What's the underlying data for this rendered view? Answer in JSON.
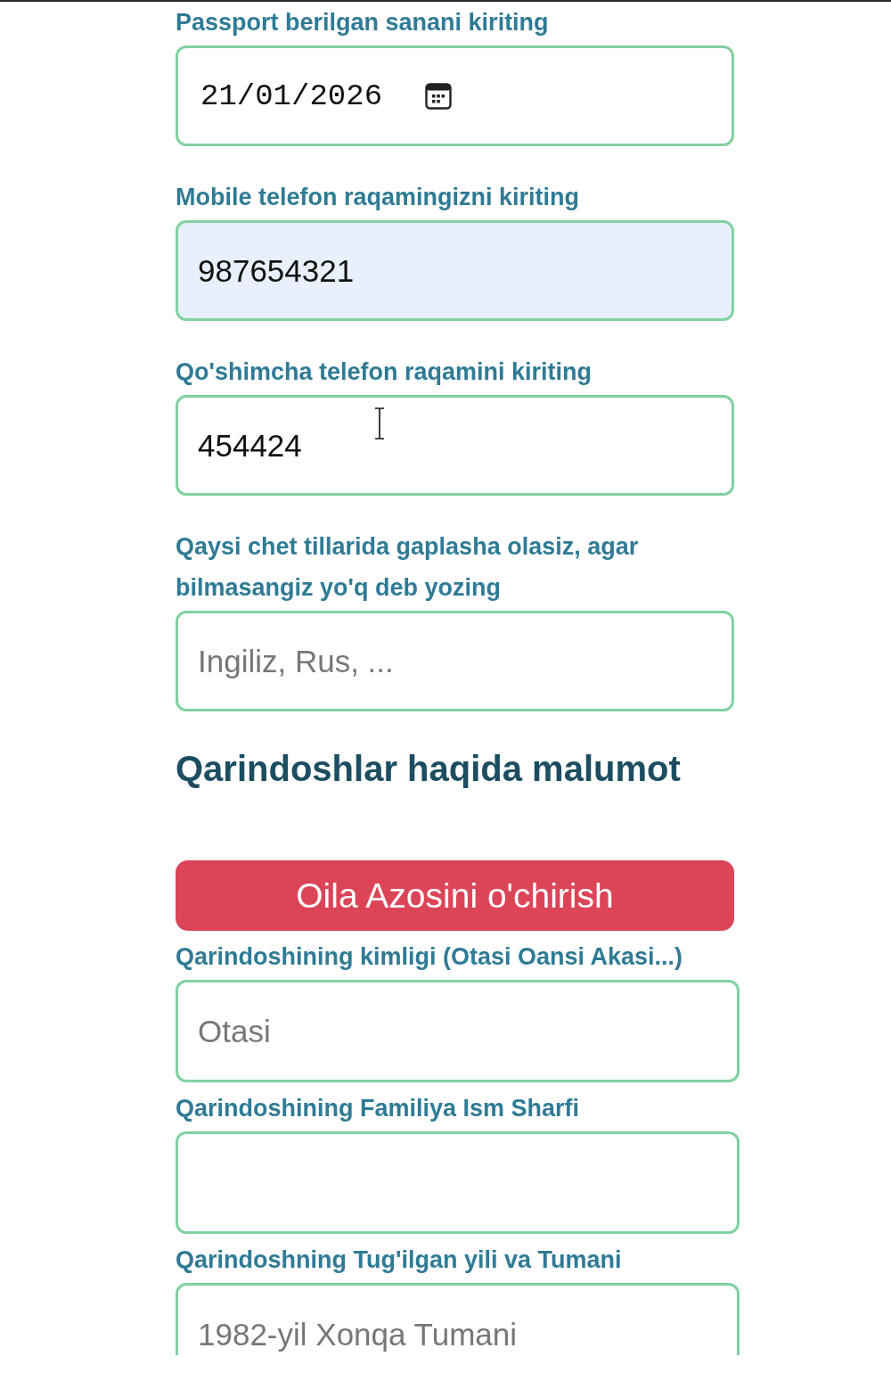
{
  "applicant_fields": [
    {
      "kind": "date",
      "label": "Passport berilgan sanani kiriting",
      "value": "21/01/2026",
      "autofilled": false
    },
    {
      "kind": "text",
      "label": "Mobile telefon raqamingizni kiriting",
      "value": "987654321",
      "autofilled": true
    },
    {
      "kind": "text",
      "label": "Qo'shimcha telefon raqamini kiriting",
      "value": "454424",
      "autofilled": false
    },
    {
      "kind": "text",
      "label": "Qaysi chet tillarida gaplasha olasiz, agar bilmasangiz yo'q deb yozing",
      "placeholder": "Ingiliz, Rus, ...",
      "autofilled": false
    }
  ],
  "relatives": {
    "heading": "Qarindoshlar haqida malumot",
    "remove_button": "Oila Azosini o'chirish",
    "fields": [
      {
        "kind": "text",
        "label": "Qarindoshining kimligi (Otasi Oansi Akasi...)",
        "placeholder": "Otasi",
        "autofilled": false
      },
      {
        "kind": "text",
        "label": "Qarindoshining Familiya Ism Sharfi",
        "autofilled": false
      },
      {
        "kind": "text",
        "label": "Qarindoshning Tug'ilgan yili va Tumani",
        "placeholder": "1982-yil Xonqa Tumani",
        "autofilled": false
      }
    ]
  }
}
